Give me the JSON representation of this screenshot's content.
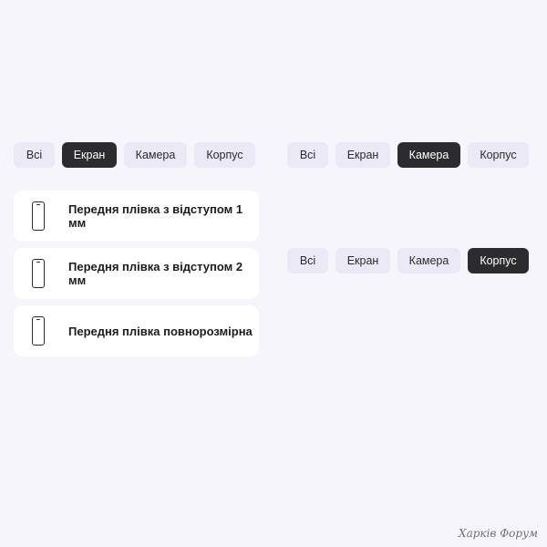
{
  "colors": {
    "background": "#f6f5fb",
    "tab_inactive": "#ece9f7",
    "tab_active": "#2c2c2e",
    "card_background": "#ffffff"
  },
  "tab_groups": [
    {
      "active": "Екран",
      "tabs": [
        "Всі",
        "Екран",
        "Камера",
        "Корпус"
      ]
    },
    {
      "active": "Камера",
      "tabs": [
        "Всі",
        "Екран",
        "Камера",
        "Корпус"
      ]
    },
    {
      "active": "Корпус",
      "tabs": [
        "Всі",
        "Екран",
        "Камера",
        "Корпус"
      ]
    }
  ],
  "cards": [
    {
      "icon": "phone-icon",
      "label": "Передня плівка з відступом 1 мм"
    },
    {
      "icon": "phone-icon",
      "label": "Передня плівка з відступом 2 мм"
    },
    {
      "icon": "phone-icon",
      "label": "Передня плівка повнорозмірна"
    }
  ],
  "watermark": "Харків Форум"
}
